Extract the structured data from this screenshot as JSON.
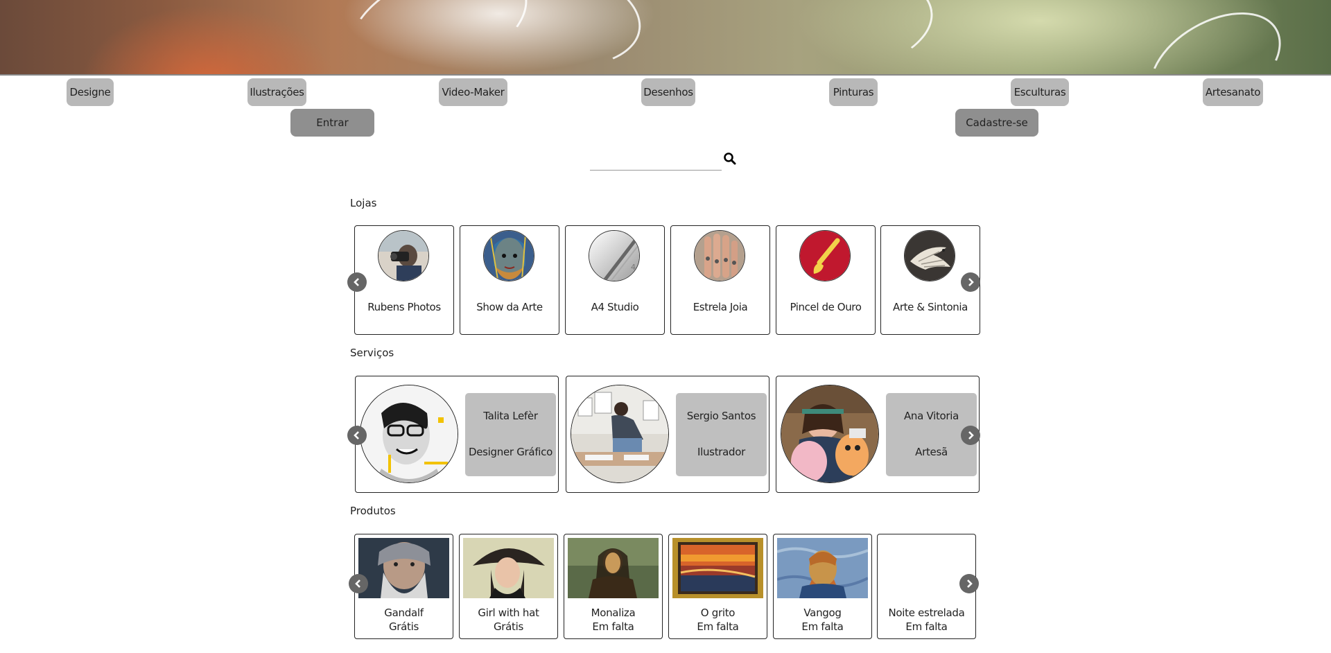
{
  "nav": {
    "categories": [
      "Designe",
      "Ilustrações",
      "Video-Maker",
      "Desenhos",
      "Pinturas",
      "Esculturas",
      "Artesanato"
    ],
    "login_label": "Entrar",
    "signup_label": "Cadastre-se"
  },
  "search": {
    "placeholder": "",
    "value": "",
    "icon": "search-icon"
  },
  "sections": {
    "shops": "Lojas",
    "services": "Serviços",
    "products": "Produtos"
  },
  "shops": [
    {
      "name": "Rubens Photos",
      "icon": "photographer-avatar"
    },
    {
      "name": "Show da Arte",
      "icon": "mosaic-face-avatar"
    },
    {
      "name": "A4 Studio",
      "icon": "a4-logo"
    },
    {
      "name": "Estrela Joia",
      "icon": "rings-avatar"
    },
    {
      "name": "Pincel de Ouro",
      "icon": "paintbrush-logo"
    },
    {
      "name": "Arte & Sintonia",
      "icon": "carved-bird-avatar"
    }
  ],
  "services": [
    {
      "name": "Talita Lefèr",
      "role": "Designer Gráfico"
    },
    {
      "name": "Sergio Santos",
      "role": "Ilustrador"
    },
    {
      "name": "Ana Vitoria",
      "role": "Artesã"
    }
  ],
  "products": [
    {
      "name": "Gandalf",
      "status": "Grátis"
    },
    {
      "name": "Girl with hat",
      "status": "Grátis"
    },
    {
      "name": "Monaliza",
      "status": "Em falta"
    },
    {
      "name": "O grito",
      "status": "Em falta"
    },
    {
      "name": "Vangog",
      "status": "Em falta"
    },
    {
      "name": "Noite estrelada",
      "status": "Em falta"
    }
  ],
  "colors": {
    "nav_button": "#b8b8b8",
    "auth_button": "#8f8f8f",
    "arrow": "#666666",
    "service_info": "#bfbfbf"
  }
}
